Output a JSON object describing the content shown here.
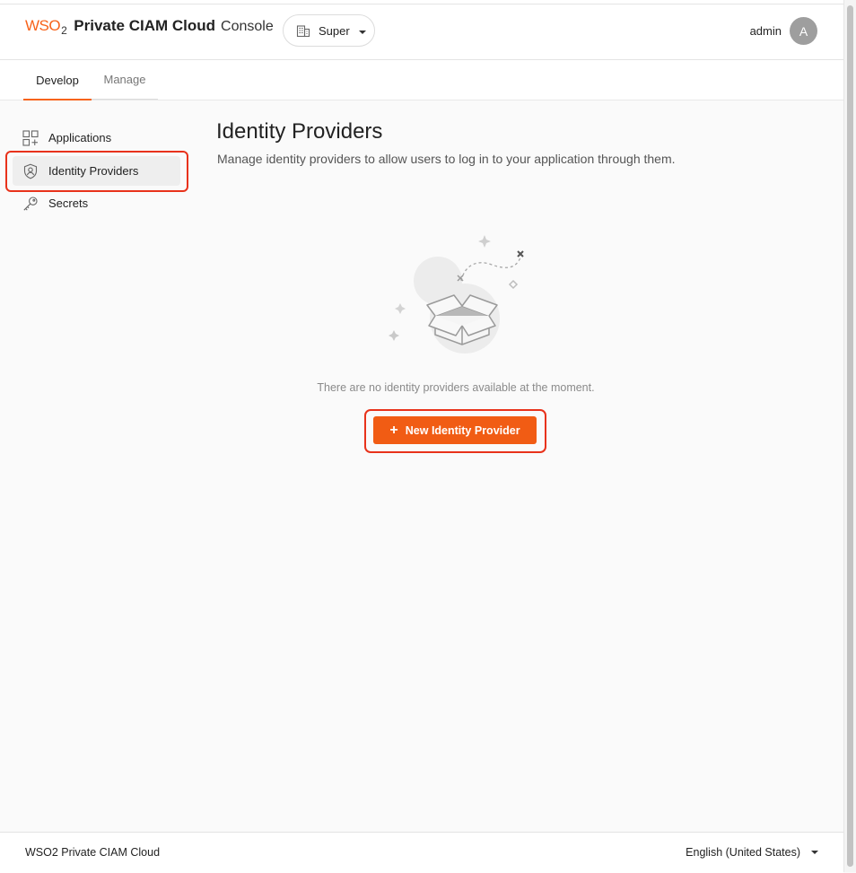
{
  "header": {
    "logo_text": "WSO",
    "logo_sub": "2",
    "product_name": "Private CIAM Cloud",
    "console_label": "Console",
    "tenant": "Super",
    "user_name": "admin",
    "avatar_initial": "A"
  },
  "tabs": [
    {
      "label": "Develop",
      "active": true
    },
    {
      "label": "Manage",
      "active": false
    }
  ],
  "sidebar": {
    "items": [
      {
        "label": "Applications",
        "icon": "applications-icon"
      },
      {
        "label": "Identity Providers",
        "icon": "identity-provider-icon",
        "active": true
      },
      {
        "label": "Secrets",
        "icon": "key-icon"
      }
    ]
  },
  "main": {
    "title": "Identity Providers",
    "description": "Manage identity providers to allow users to log in to your application through them.",
    "empty_message": "There are no identity providers available at the moment.",
    "new_button_label": "New Identity Provider"
  },
  "footer": {
    "brand": "WSO2 Private CIAM Cloud",
    "language": "English (United States)"
  },
  "colors": {
    "accent": "#f15c14",
    "highlight": "#e8321b"
  }
}
